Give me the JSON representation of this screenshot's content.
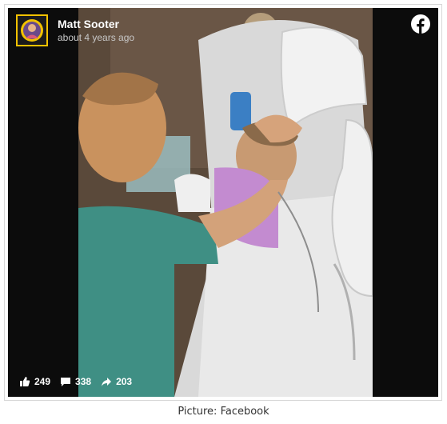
{
  "post": {
    "author": "Matt Sooter",
    "time": "about 4 years ago",
    "likes": "249",
    "comments": "338",
    "shares": "203"
  },
  "caption": "Picture: Facebook",
  "icons": {
    "brand": "facebook-icon",
    "like": "thumbs-up-icon",
    "comment": "comment-icon",
    "share": "share-arrow-icon"
  },
  "colors": {
    "post_background": "#0c0c0c",
    "avatar_border": "#f2c200",
    "text": "#ffffff"
  }
}
